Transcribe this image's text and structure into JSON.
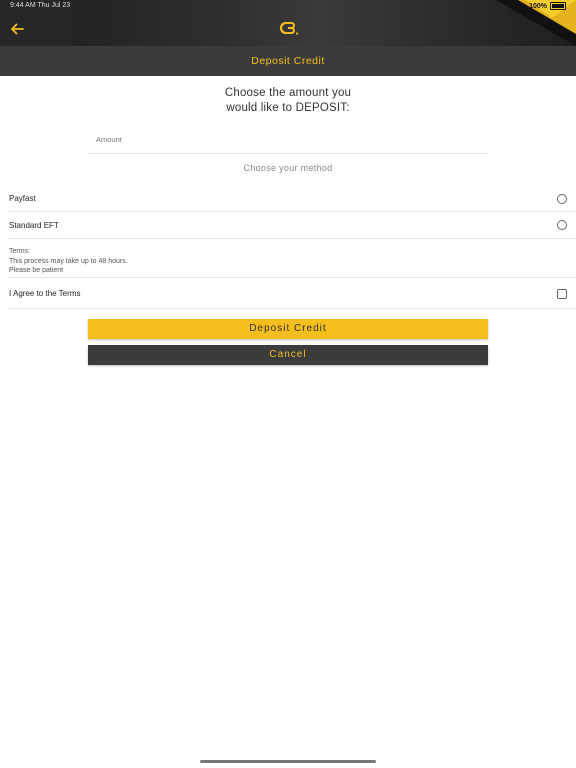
{
  "status_bar": {
    "time": "9:44 AM   Thu Jul 23",
    "battery": "100%"
  },
  "header": {
    "back_icon": "arrow-left-icon",
    "logo_icon": "brand-logo-icon",
    "title": "Deposit Credit"
  },
  "form": {
    "prompt_line1": "Choose the amount you",
    "prompt_line2": "would like to DEPOSIT:",
    "amount_placeholder": "Amount",
    "method_label": "Choose your method",
    "methods": [
      {
        "label": "Payfast"
      },
      {
        "label": "Standard EFT"
      }
    ],
    "terms": {
      "line1": "Terms:",
      "line2": "This process may take up to 48 hours.",
      "line3": "Please be patient"
    },
    "agree_label": "I Agree to the Terms"
  },
  "buttons": {
    "deposit": "Deposit Credit",
    "cancel": "Cancel"
  },
  "colors": {
    "accent": "#f4be1d",
    "dark": "#3b3b3b"
  }
}
